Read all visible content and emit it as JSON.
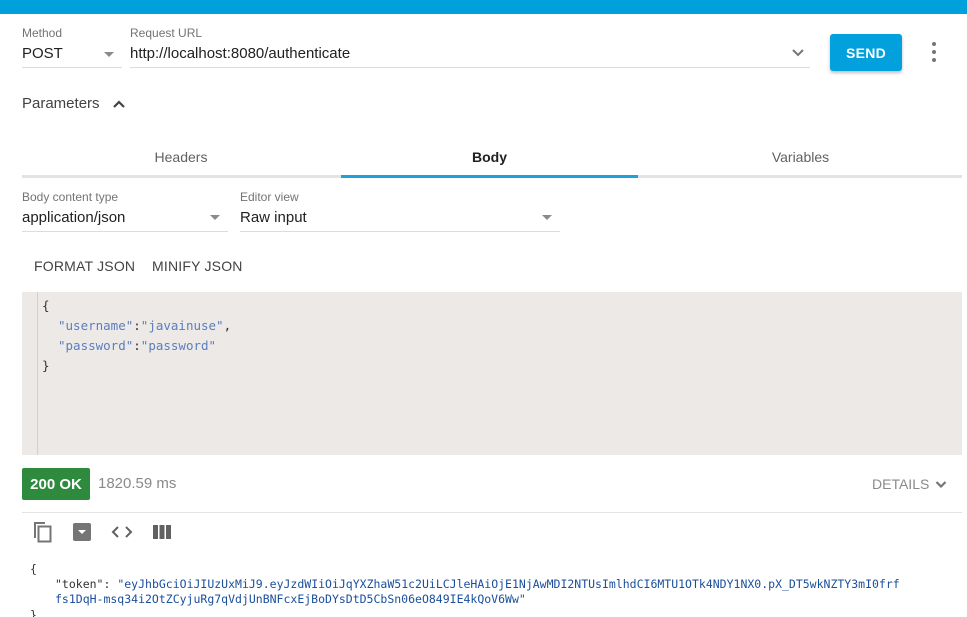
{
  "theme": {
    "accent": "#00a0dc",
    "success": "#2e8b3e"
  },
  "request": {
    "method_label": "Method",
    "method_value": "POST",
    "url_label": "Request URL",
    "url_value": "http://localhost:8080/authenticate",
    "send_label": "SEND",
    "more_icon": "more-vert-icon",
    "url_history_icon": "chevron-down-icon"
  },
  "parameters": {
    "label": "Parameters",
    "toggle_icon": "chevron-up-icon"
  },
  "tabs": [
    {
      "label": "Headers",
      "active": false
    },
    {
      "label": "Body",
      "active": true
    },
    {
      "label": "Variables",
      "active": false
    }
  ],
  "body": {
    "content_type_label": "Body content type",
    "content_type_value": "application/json",
    "editor_view_label": "Editor view",
    "editor_view_value": "Raw input",
    "format_label": "FORMAT JSON",
    "minify_label": "MINIFY JSON",
    "editor_lines": {
      "open": "{",
      "username_key": "\"username\"",
      "username_value": "\"javainuse\"",
      "password_key": "\"password\"",
      "password_value": "\"password\"",
      "colon": ":",
      "comma": ",",
      "close": "}"
    }
  },
  "response": {
    "status": "200 OK",
    "time": "1820.59 ms",
    "details_label": "DETAILS",
    "toolbar_icons": [
      "copy-icon",
      "save-icon",
      "code-icon",
      "columns-icon"
    ],
    "json": {
      "open": "{",
      "token_key": "\"token\"",
      "sep": ": ",
      "token_line1": "\"eyJhbGciOiJIUzUxMiJ9.eyJzdWIiOiJqYXZhaW51c2UiLCJleHAiOjE1NjAwMDI2NTUsImlhdCI6MTU1OTk4NDY1NX0.pX_DT5wkNZTY3mI0frf",
      "token_line2": "fs1DqH-msq34i2OtZCyjuRg7qVdjUnBNFcxEjBoDYsDtD5CbSn06eO849IE4kQoV6Ww\"",
      "close": "}"
    }
  }
}
